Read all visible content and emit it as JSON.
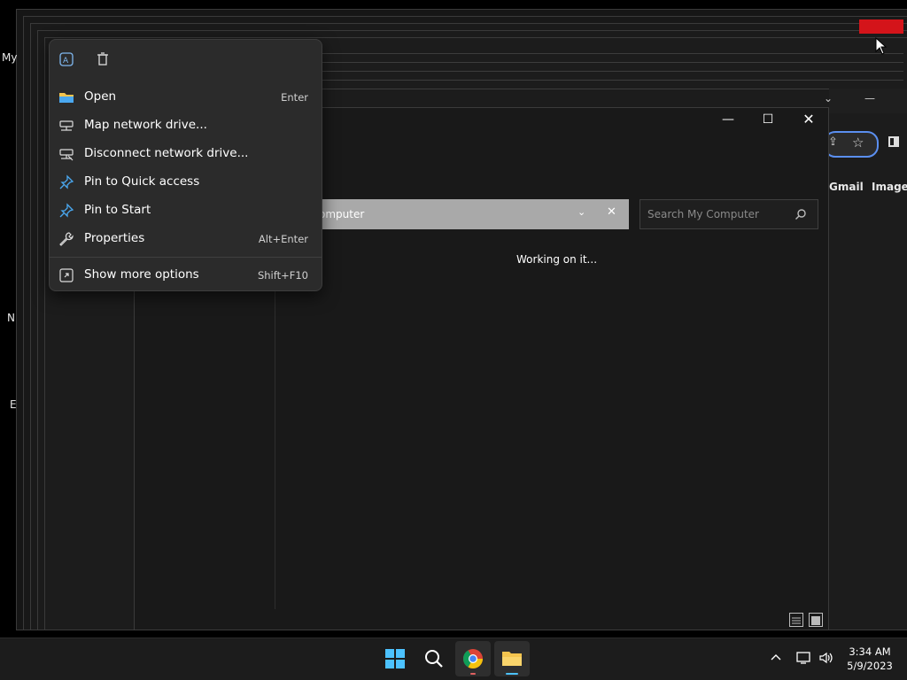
{
  "desktop": {
    "labels": [
      "My",
      "N",
      "E"
    ]
  },
  "browser": {
    "links": [
      "Gmail",
      "Images"
    ]
  },
  "explorer": {
    "address_text": "omputer",
    "search_placeholder": "Search My Computer",
    "status": "Working on it..."
  },
  "context_menu": {
    "top_icons": [
      "ai-rewrite-icon",
      "trash-icon"
    ],
    "items": [
      {
        "label": "Open",
        "shortcut": "Enter",
        "icon": "folder-icon"
      },
      {
        "label": "Map network drive...",
        "shortcut": "",
        "icon": "network-drive-icon"
      },
      {
        "label": "Disconnect network drive...",
        "shortcut": "",
        "icon": "disconnect-drive-icon"
      },
      {
        "label": "Pin to Quick access",
        "shortcut": "",
        "icon": "pin-icon"
      },
      {
        "label": "Pin to Start",
        "shortcut": "",
        "icon": "pin-icon"
      },
      {
        "label": "Properties",
        "shortcut": "Alt+Enter",
        "icon": "wrench-icon"
      },
      {
        "label": "Show more options",
        "shortcut": "Shift+F10",
        "icon": "more-options-icon"
      }
    ]
  },
  "taskbar": {
    "time": "3:34 AM",
    "date": "5/9/2023",
    "apps": [
      "start-icon",
      "search-icon",
      "chrome-icon",
      "file-explorer-icon"
    ]
  },
  "colors": {
    "accent": "#4aa8f0",
    "folder": "#f4c44e",
    "red": "#d4141a"
  }
}
